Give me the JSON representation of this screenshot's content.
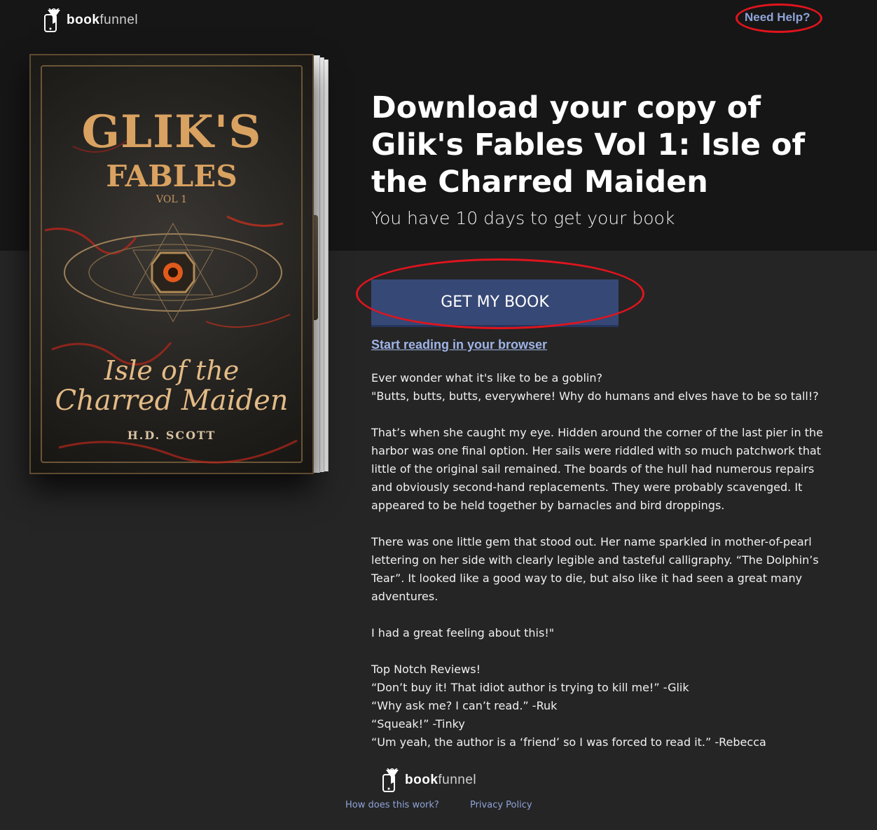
{
  "brand": {
    "name_bold": "book",
    "name_light": "funnel"
  },
  "header": {
    "help_link": "Need Help?"
  },
  "cover": {
    "title_line1": "GLIK'S",
    "title_line2": "FABLES",
    "volume": "VOL 1",
    "subtitle_line1": "Isle of the",
    "subtitle_line2": "Charred Maiden",
    "author": "H.D. SCOTT"
  },
  "main": {
    "title": "Download your copy of Glik's Fables Vol 1: Isle of the Charred Maiden",
    "subtitle": "You have 10 days to get your book",
    "cta_label": "GET MY BOOK",
    "read_link": "Start reading in your browser"
  },
  "description": {
    "p1_line1": "Ever wonder what it's like to be a goblin?",
    "p1_line2": "\"Butts, butts, butts, everywhere! Why do humans and elves have to be so tall!?",
    "p2": "That’s when she caught my eye. Hidden around the corner of the last pier in the harbor was one final option. Her sails were riddled with so much patchwork that little of the original sail remained. The boards of the hull had numerous repairs and obviously second-hand replacements. They were probably scavenged. It appeared to be held together by barnacles and bird droppings.",
    "p3": "There was one little gem that stood out. Her name sparkled in mother-of-pearl lettering on her side with clearly legible and tasteful calligraphy. “The Dolphin’s Tear”. It looked like a good way to die, but also like it had seen a great many adventures.",
    "p4": "I had a great feeling about this!\"",
    "reviews_heading": "Top Notch Reviews!",
    "reviews": [
      "“Don’t buy it! That idiot author is trying to kill me!” -Glik",
      "“Why ask me? I can’t read.” -Ruk",
      "“Squeak!” -Tinky",
      "“Um yeah, the author is a ‘friend’ so I was forced to read it.” -Rebecca"
    ]
  },
  "footer": {
    "how_link": "How does this work?",
    "privacy_link": "Privacy Policy"
  },
  "colors": {
    "header_bg": "#161616",
    "page_bg": "#252525",
    "button_bg": "#364876",
    "link": "#8fa3d8",
    "annotation_ring": "#e0141d"
  }
}
